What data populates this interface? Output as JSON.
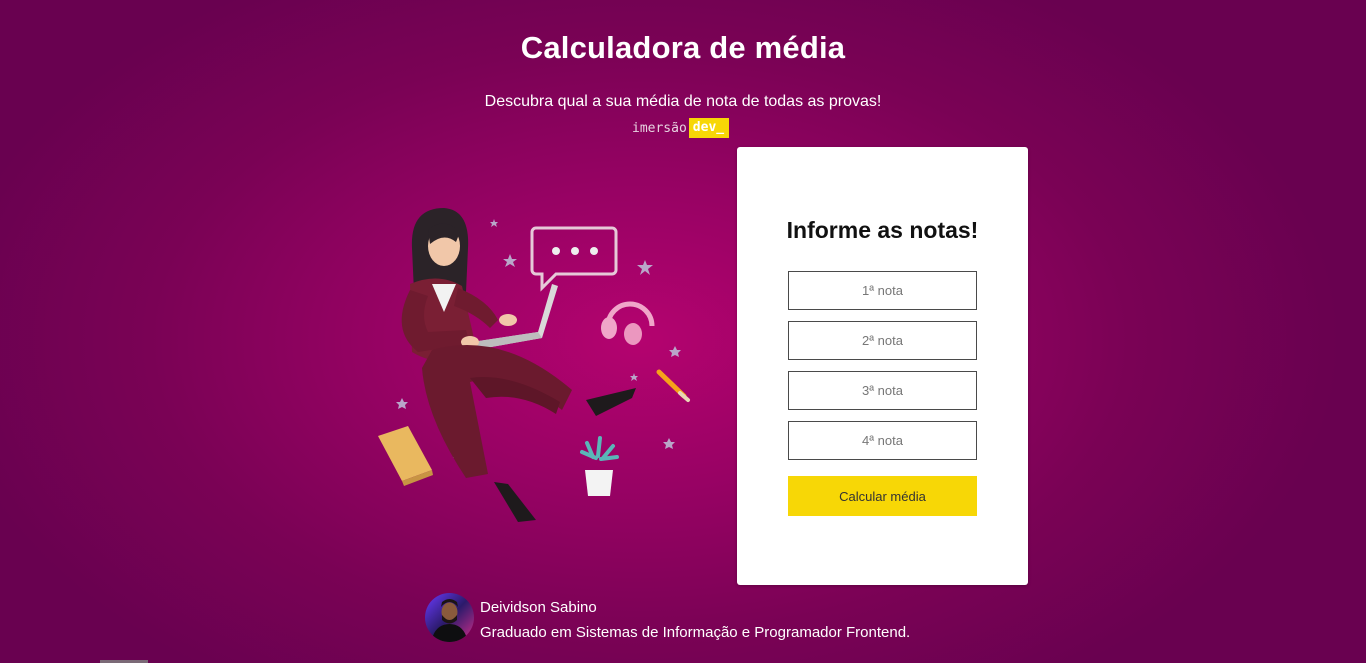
{
  "header": {
    "title": "Calculadora de média",
    "subtitle": "Descubra qual a sua média de nota de todas as provas!",
    "brand_word": "imersão",
    "brand_badge": "dev_"
  },
  "form": {
    "title": "Informe as notas!",
    "inputs": [
      {
        "placeholder": "1ª nota",
        "value": ""
      },
      {
        "placeholder": "2ª nota",
        "value": ""
      },
      {
        "placeholder": "3ª nota",
        "value": ""
      },
      {
        "placeholder": "4ª nota",
        "value": ""
      }
    ],
    "button_label": "Calcular média"
  },
  "author": {
    "name": "Deividson Sabino",
    "bio": "Graduado em Sistemas de Informação e Programador Frontend."
  },
  "icons": [
    "laptop-woman-illustration",
    "speech-bubble-icon",
    "headphones-icon",
    "pencil-icon",
    "book-icon",
    "plant-icon",
    "star-icon"
  ],
  "colors": {
    "background": "#980264",
    "background_dark": "#690150",
    "accent": "#f7d706",
    "card": "#ffffff",
    "text_light": "#ffffff",
    "text_dark": "#111111"
  }
}
